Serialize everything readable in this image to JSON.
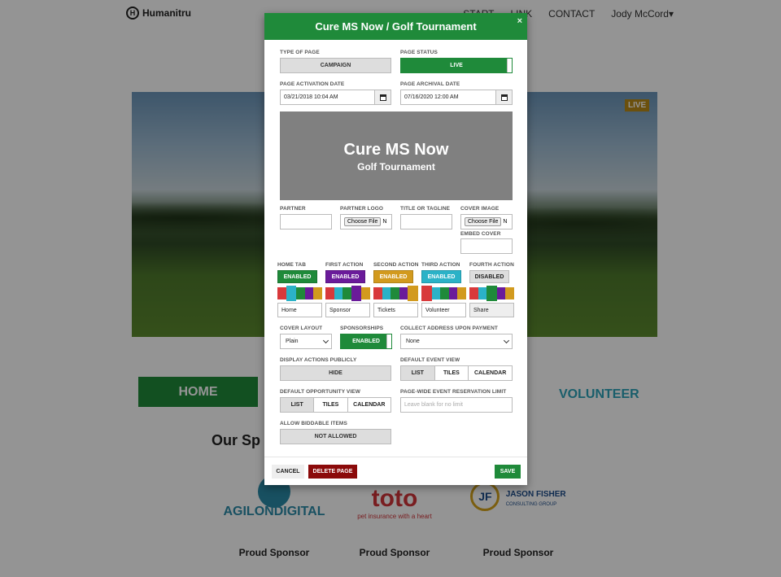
{
  "background": {
    "brand": "Humanitru",
    "nav": [
      "START",
      "LINK",
      "CONTACT",
      "Jody McCord"
    ],
    "live_badge": "LIVE",
    "home_button": "HOME",
    "volunteer_link": "VOLUNTEER",
    "sponsors_heading": "Our Sp",
    "sponsors": [
      {
        "name": "AGILONDIGITAL",
        "caption": "Proud Sponsor"
      },
      {
        "name": "toto",
        "sub": "pet insurance with a heart",
        "caption": "Proud Sponsor"
      },
      {
        "name": "JASON FISHER",
        "sub": "CONSULTING GROUP",
        "badge": "JF",
        "caption": "Proud Sponsor"
      }
    ]
  },
  "modal": {
    "title": "Cure MS Now / Golf Tournament",
    "close": "×",
    "type_of_page": {
      "label": "TYPE OF PAGE",
      "value": "CAMPAIGN"
    },
    "page_status": {
      "label": "PAGE STATUS",
      "value": "LIVE"
    },
    "activation_date": {
      "label": "PAGE ACTIVATION DATE",
      "value": "03/21/2018 10:04 AM"
    },
    "archival_date": {
      "label": "PAGE ARCHIVAL DATE",
      "value": "07/16/2020 12:00 AM"
    },
    "preview": {
      "title": "Cure MS Now",
      "subtitle": "Golf Tournament"
    },
    "partner": {
      "label": "PARTNER",
      "value": ""
    },
    "partner_logo": {
      "label": "PARTNER LOGO",
      "button": "Choose File",
      "text": "N"
    },
    "title_tagline": {
      "label": "TITLE OR TAGLINE",
      "value": ""
    },
    "cover_image": {
      "label": "COVER IMAGE",
      "button": "Choose File",
      "text": "N"
    },
    "embed_cover": {
      "label": "EMBED COVER",
      "value": ""
    },
    "actions": [
      {
        "label": "HOME TAB",
        "state": "ENABLED",
        "color": "#1f8a3a",
        "text": "Home",
        "selected": 1
      },
      {
        "label": "FIRST ACTION",
        "state": "ENABLED",
        "color": "#6a1b9a",
        "text": "Sponsor",
        "selected": 3
      },
      {
        "label": "SECOND ACTION",
        "state": "ENABLED",
        "color": "#d29a1e",
        "text": "Tickets",
        "selected": 4
      },
      {
        "label": "THIRD ACTION",
        "state": "ENABLED",
        "color": "#2bb2c7",
        "text": "Volunteer",
        "selected": 0
      },
      {
        "label": "FOURTH ACTION",
        "state": "DISABLED",
        "color": "#dddddd",
        "text": "Share",
        "selected": 2
      }
    ],
    "swatch_colors": [
      "#d8393b",
      "#2bb2c7",
      "#1f8a3a",
      "#6a1b9a",
      "#d29a1e"
    ],
    "cover_layout": {
      "label": "COVER LAYOUT",
      "value": "Plain"
    },
    "sponsorships": {
      "label": "SPONSORSHIPS",
      "value": "ENABLED"
    },
    "collect_address": {
      "label": "COLLECT ADDRESS UPON PAYMENT",
      "value": "None"
    },
    "display_actions": {
      "label": "DISPLAY ACTIONS PUBLICLY",
      "value": "HIDE"
    },
    "default_event_view": {
      "label": "DEFAULT EVENT VIEW",
      "options": [
        "LIST",
        "TILES",
        "CALENDAR"
      ],
      "active": "LIST"
    },
    "default_opportunity_view": {
      "label": "DEFAULT OPPORTUNITY VIEW",
      "options": [
        "LIST",
        "TILES",
        "CALENDAR"
      ],
      "active": "LIST"
    },
    "reservation_limit": {
      "label": "PAGE-WIDE EVENT RESERVATION LIMIT",
      "placeholder": "Leave blank for no limit"
    },
    "biddable_items": {
      "label": "ALLOW BIDDABLE ITEMS",
      "value": "NOT ALLOWED"
    },
    "footer": {
      "cancel": "CANCEL",
      "delete": "DELETE PAGE",
      "save": "SAVE"
    }
  }
}
